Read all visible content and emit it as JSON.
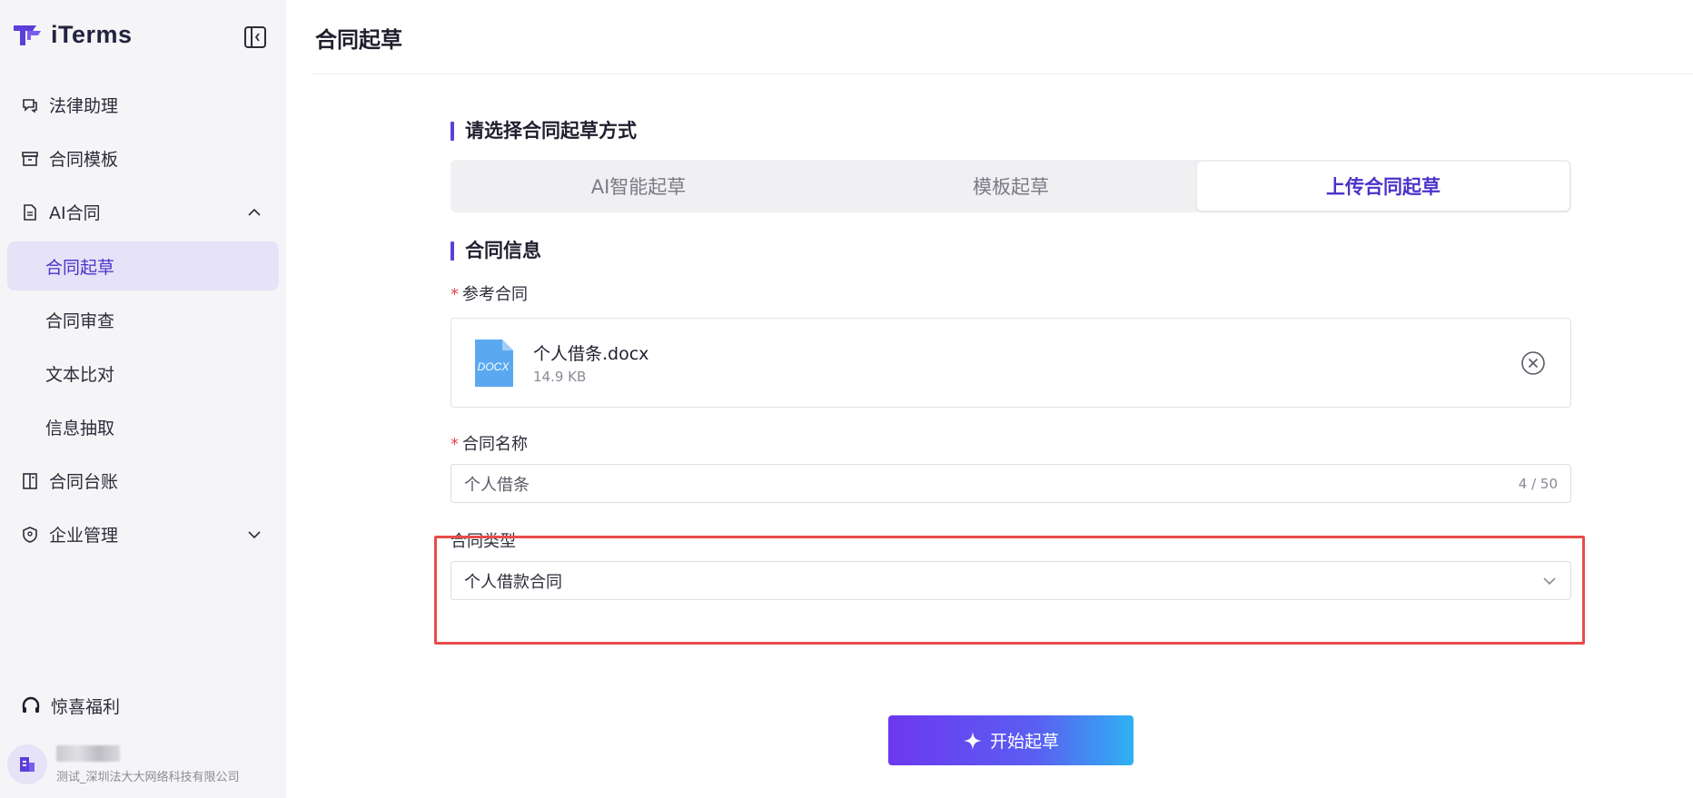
{
  "app": {
    "brand": "iTerms",
    "page_title": "合同起草"
  },
  "sidebar": {
    "items": [
      {
        "label": "法律助理",
        "icon": "chat-icon"
      },
      {
        "label": "合同模板",
        "icon": "archive-icon"
      },
      {
        "label": "AI合同",
        "icon": "document-icon",
        "expanded": true,
        "children": [
          {
            "label": "合同起草",
            "active": true
          },
          {
            "label": "合同审查"
          },
          {
            "label": "文本比对"
          },
          {
            "label": "信息抽取"
          }
        ]
      },
      {
        "label": "合同台账",
        "icon": "ledger-icon"
      },
      {
        "label": "企业管理",
        "icon": "shield-icon",
        "expanded": false
      }
    ],
    "bottom_link": "惊喜福利",
    "user_org": "测试_深圳法大大网络科技有限公司"
  },
  "main": {
    "method_section_title": "请选择合同起草方式",
    "tabs": [
      {
        "label": "AI智能起草",
        "active": false
      },
      {
        "label": "模板起草",
        "active": false
      },
      {
        "label": "上传合同起草",
        "active": true
      }
    ],
    "info_section_title": "合同信息",
    "reference_label": "参考合同",
    "required_mark": "*",
    "file": {
      "name": "个人借条.docx",
      "size": "14.9 KB",
      "type_badge": "DOCX"
    },
    "name_label": "合同名称",
    "name_value": "个人借条",
    "name_counter": "4 / 50",
    "type_label": "合同类型",
    "type_value": "个人借款合同",
    "start_button": "开始起草"
  },
  "colors": {
    "accent": "#4a33c9",
    "highlight": "#e84c4c"
  }
}
